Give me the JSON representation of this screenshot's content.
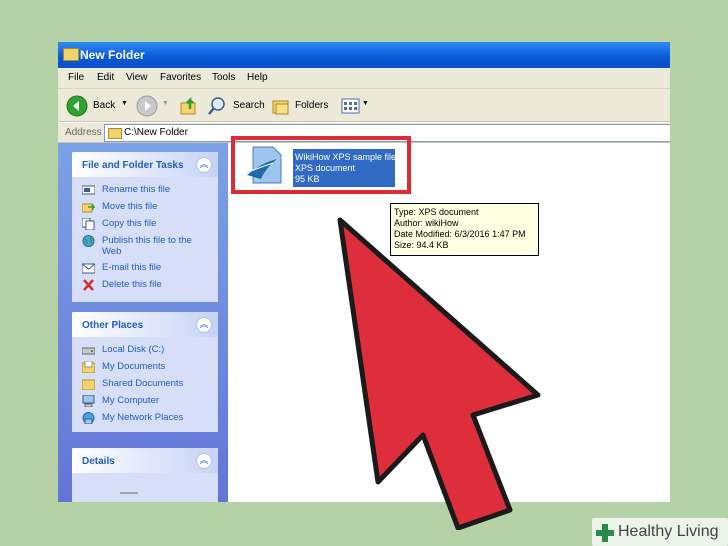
{
  "window": {
    "title": "New Folder"
  },
  "menu": [
    "File",
    "Edit",
    "View",
    "Favorites",
    "Tools",
    "Help"
  ],
  "toolbar": {
    "back": "Back",
    "search": "Search",
    "folders": "Folders"
  },
  "address": {
    "label": "Address",
    "value": "C:\\New Folder"
  },
  "left_pane": {
    "tasks": {
      "title": "File and Folder Tasks",
      "items": [
        "Rename this file",
        "Move this file",
        "Copy this file",
        "Publish this file to the Web",
        "E-mail this file",
        "Delete this file"
      ]
    },
    "places": {
      "title": "Other Places",
      "items": [
        "Local Disk (C:)",
        "My Documents",
        "Shared Documents",
        "My Computer",
        "My Network Places"
      ]
    },
    "details": {
      "title": "Details"
    }
  },
  "file": {
    "name": "WikiHow XPS sample file",
    "type": "XPS document",
    "size": "95 KB"
  },
  "tooltip": {
    "type": "Type: XPS document",
    "author": "Author: wikiHow",
    "modified": "Date Modified: 6/3/2016 1:47 PM",
    "size": "Size: 94.4 KB"
  },
  "watermark": {
    "brand": "Healthy Living"
  },
  "colors": {
    "highlight": "#e02a36",
    "selection": "#316ac5",
    "background": "#b5d1a6"
  }
}
